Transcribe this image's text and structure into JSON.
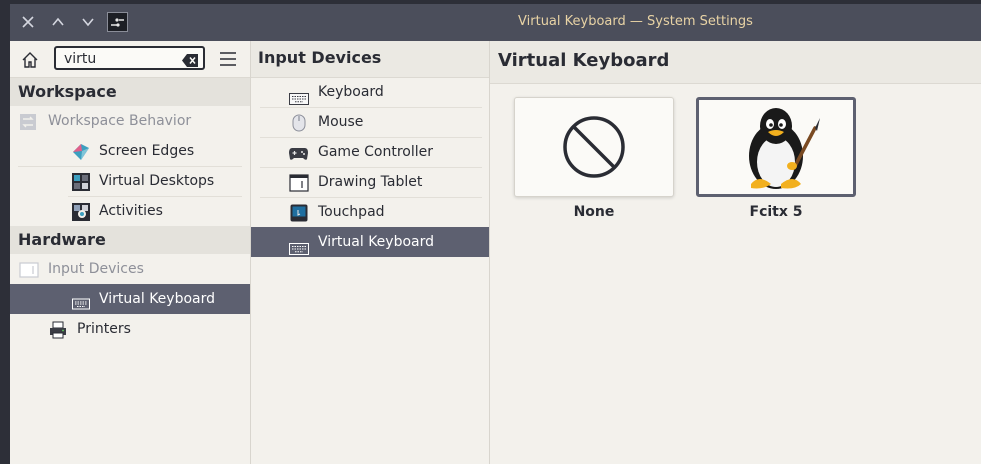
{
  "window": {
    "title": "Virtual Keyboard — System Settings"
  },
  "search": {
    "value": "virtu"
  },
  "sidebar": {
    "categories": [
      {
        "label": "Workspace",
        "items": [
          {
            "label": "Workspace Behavior",
            "muted": true
          },
          {
            "label": "Screen Edges"
          },
          {
            "label": "Virtual Desktops"
          },
          {
            "label": "Activities"
          }
        ]
      },
      {
        "label": "Hardware",
        "items": [
          {
            "label": "Input Devices",
            "muted": true
          },
          {
            "label": "Virtual Keyboard",
            "selected": true
          },
          {
            "label": "Printers"
          }
        ]
      }
    ]
  },
  "subpanel": {
    "title": "Input Devices",
    "items": [
      {
        "label": "Keyboard"
      },
      {
        "label": "Mouse"
      },
      {
        "label": "Game Controller"
      },
      {
        "label": "Drawing Tablet"
      },
      {
        "label": "Touchpad"
      },
      {
        "label": "Virtual Keyboard",
        "selected": true
      }
    ]
  },
  "content": {
    "title": "Virtual Keyboard",
    "options": [
      {
        "label": "None",
        "icon": "no-entry-icon"
      },
      {
        "label": "Fcitx 5",
        "icon": "penguin-icon",
        "selected": true
      }
    ]
  },
  "colors": {
    "titlebar": "#4b4e5b",
    "title_text": "#e8d3a5",
    "selection": "#5d6070",
    "background": "#f3f1ec"
  }
}
